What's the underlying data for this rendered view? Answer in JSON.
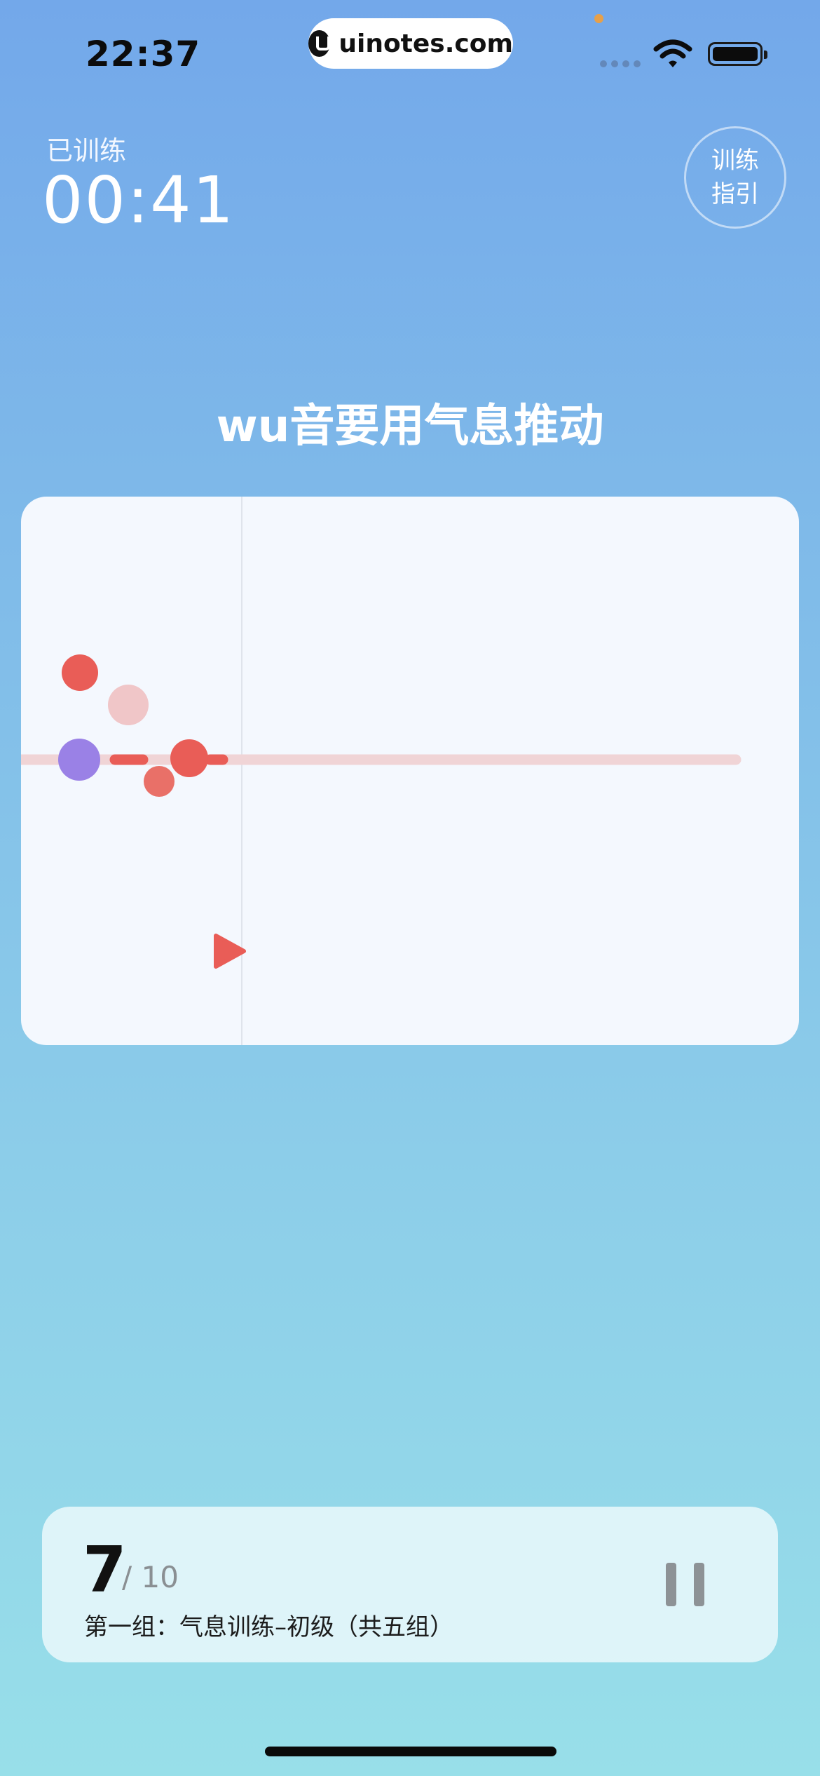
{
  "status_bar": {
    "time": "22:37",
    "watermark": "uinotes.com",
    "icons": [
      "signal-icon",
      "wifi-icon",
      "battery-icon"
    ]
  },
  "header": {
    "elapsed_label": "已训练",
    "elapsed_time": "00:41",
    "guide_line1": "训练",
    "guide_line2": "指引"
  },
  "prompt": "wu音要用气息推动",
  "progress": {
    "current": "7",
    "total": "/ 10",
    "group_label": "第一组：气息训练–初级（共五组）"
  },
  "colors": {
    "accent_red": "#e95d57",
    "user_voice": "#9a81e6",
    "target_track": "#f0d4d6",
    "card_bg": "#f4f8fe"
  },
  "icons": {
    "pause": "pause-icon",
    "play_marker": "play-marker-icon"
  }
}
